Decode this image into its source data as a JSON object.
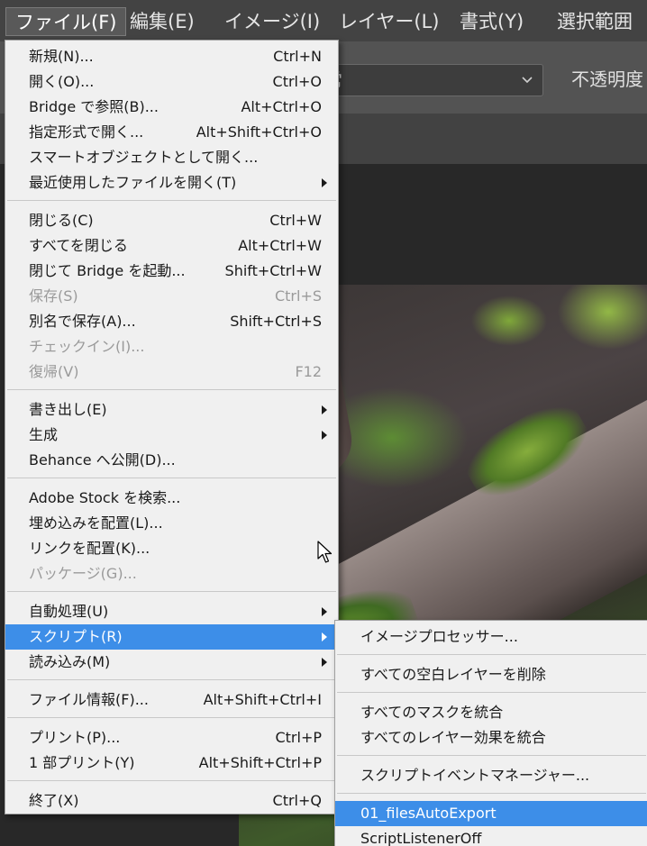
{
  "menubar": {
    "items": [
      {
        "label": "ファイル(F)"
      },
      {
        "label": "編集(E)"
      },
      {
        "label": "イメージ(I)"
      },
      {
        "label": "レイヤー(L)"
      },
      {
        "label": "書式(Y)"
      },
      {
        "label": "選択範囲"
      }
    ]
  },
  "options_bar": {
    "mode_value": "常",
    "opacity_label": "不透明度"
  },
  "file_menu": {
    "items": [
      {
        "label": "新規(N)...",
        "shortcut": "Ctrl+N"
      },
      {
        "label": "開く(O)...",
        "shortcut": "Ctrl+O"
      },
      {
        "label": "Bridge で参照(B)...",
        "shortcut": "Alt+Ctrl+O"
      },
      {
        "label": "指定形式で開く...",
        "shortcut": "Alt+Shift+Ctrl+O"
      },
      {
        "label": "スマートオブジェクトとして開く...",
        "shortcut": ""
      },
      {
        "label": "最近使用したファイルを開く(T)",
        "shortcut": ""
      },
      {
        "label": "閉じる(C)",
        "shortcut": "Ctrl+W"
      },
      {
        "label": "すべてを閉じる",
        "shortcut": "Alt+Ctrl+W"
      },
      {
        "label": "閉じて Bridge を起動...",
        "shortcut": "Shift+Ctrl+W"
      },
      {
        "label": "保存(S)",
        "shortcut": "Ctrl+S"
      },
      {
        "label": "別名で保存(A)...",
        "shortcut": "Shift+Ctrl+S"
      },
      {
        "label": "チェックイン(I)...",
        "shortcut": ""
      },
      {
        "label": "復帰(V)",
        "shortcut": "F12"
      },
      {
        "label": "書き出し(E)",
        "shortcut": ""
      },
      {
        "label": "生成",
        "shortcut": ""
      },
      {
        "label": "Behance へ公開(D)...",
        "shortcut": ""
      },
      {
        "label": "Adobe Stock を検索...",
        "shortcut": ""
      },
      {
        "label": "埋め込みを配置(L)...",
        "shortcut": ""
      },
      {
        "label": "リンクを配置(K)...",
        "shortcut": ""
      },
      {
        "label": "パッケージ(G)...",
        "shortcut": ""
      },
      {
        "label": "自動処理(U)",
        "shortcut": ""
      },
      {
        "label": "スクリプト(R)",
        "shortcut": ""
      },
      {
        "label": "読み込み(M)",
        "shortcut": ""
      },
      {
        "label": "ファイル情報(F)...",
        "shortcut": "Alt+Shift+Ctrl+I"
      },
      {
        "label": "プリント(P)...",
        "shortcut": "Ctrl+P"
      },
      {
        "label": "1 部プリント(Y)",
        "shortcut": "Alt+Shift+Ctrl+P"
      },
      {
        "label": "終了(X)",
        "shortcut": "Ctrl+Q"
      }
    ]
  },
  "script_menu": {
    "items": [
      {
        "label": "イメージプロセッサー..."
      },
      {
        "label": "すべての空白レイヤーを削除"
      },
      {
        "label": "すべてのマスクを統合"
      },
      {
        "label": "すべてのレイヤー効果を統合"
      },
      {
        "label": "スクリプトイベントマネージャー..."
      },
      {
        "label": "01_filesAutoExport"
      },
      {
        "label": "ScriptListenerOff"
      }
    ]
  },
  "colors": {
    "highlight": "#3d8ee8",
    "menu_bg": "#f0f0f0",
    "menubar_bg": "#434343"
  },
  "icons": [
    "chevron-down-icon",
    "submenu-arrow-icon",
    "mouse-cursor-icon"
  ]
}
